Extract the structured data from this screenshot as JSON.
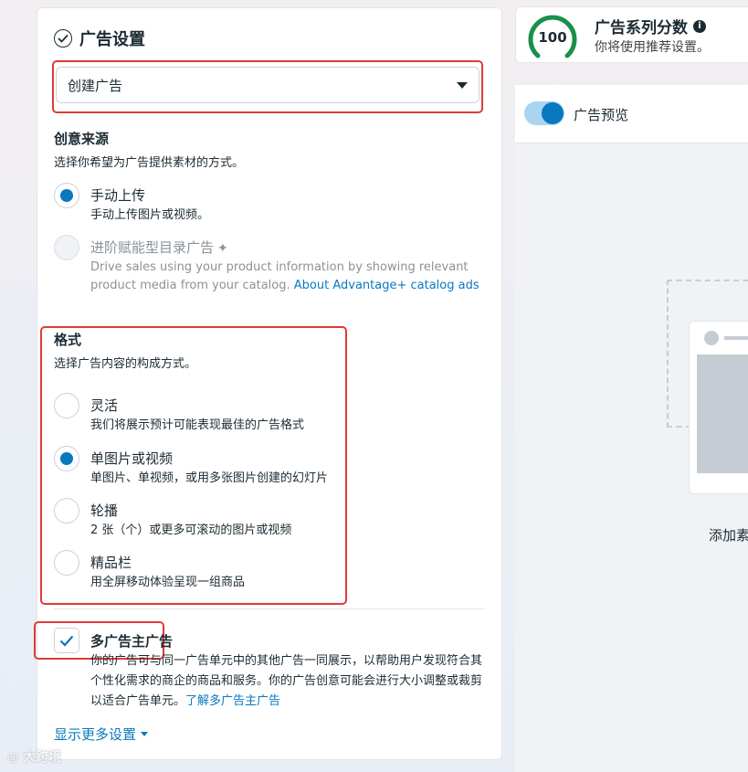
{
  "settings": {
    "title": "广告设置",
    "select_value": "创建广告",
    "creative_source": {
      "title": "创意来源",
      "desc": "选择你希望为广告提供素材的方式。",
      "options": [
        {
          "label": "手动上传",
          "sub": "手动上传图片或视频。",
          "selected": true,
          "disabled": false
        },
        {
          "label": "进阶赋能型目录广告",
          "sub": "Drive sales using your product information by showing relevant product media from your catalog.",
          "link": "About Advantage+ catalog ads",
          "selected": false,
          "disabled": true
        }
      ]
    },
    "format": {
      "title": "格式",
      "desc": "选择广告内容的构成方式。",
      "options": [
        {
          "label": "灵活",
          "sub": "我们将展示预计可能表现最佳的广告格式",
          "selected": false
        },
        {
          "label": "单图片或视频",
          "sub": "单图片、单视频，或用多张图片创建的幻灯片",
          "selected": true
        },
        {
          "label": "轮播",
          "sub": "2 张（个）或更多可滚动的图片或视频",
          "selected": false
        },
        {
          "label": "精品栏",
          "sub": "用全屏移动体验呈现一组商品",
          "selected": false
        }
      ]
    },
    "multi_advertiser": {
      "checked": true,
      "label": "多广告主广告",
      "desc": "你的广告可与同一广告单元中的其他广告一同展示，以帮助用户发现符合其个性化需求的商企的商品和服务。你的广告创意可能会进行大小调整或裁剪以适合广告单元。",
      "link": "了解多广告主广告"
    },
    "show_more": "显示更多设置"
  },
  "score": {
    "value": "100",
    "title": "广告系列分数",
    "subtitle": "你将使用推荐设置。"
  },
  "preview": {
    "toggle_on": true,
    "label": "广告预览",
    "add_label": "添加素"
  },
  "watermark": "大跨境",
  "colors": {
    "accent": "#0a78be",
    "highlight_box": "#e03b35",
    "gauge": "#1a8f4a"
  }
}
